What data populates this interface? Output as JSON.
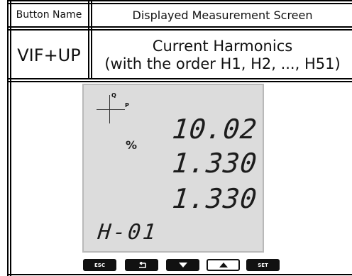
{
  "table": {
    "header": {
      "col1": "Button Name",
      "col2": "Displayed Measurement Screen"
    },
    "row": {
      "button": "VIF+UP",
      "screen_line1": "Current Harmonics",
      "screen_line2": "(with the order H1, H2, ..., H51)"
    }
  },
  "display": {
    "quadrant_q": "Q",
    "quadrant_p": "P",
    "unit": "%",
    "value1": "10.02",
    "value2": "1.330",
    "value3": "1.330",
    "harmonic_index": "H-01"
  },
  "keys": {
    "esc": "ESC",
    "back_icon": "back-arrow-icon",
    "down_icon": "down-triangle-icon",
    "up_icon": "up-triangle-icon",
    "set": "SET"
  }
}
